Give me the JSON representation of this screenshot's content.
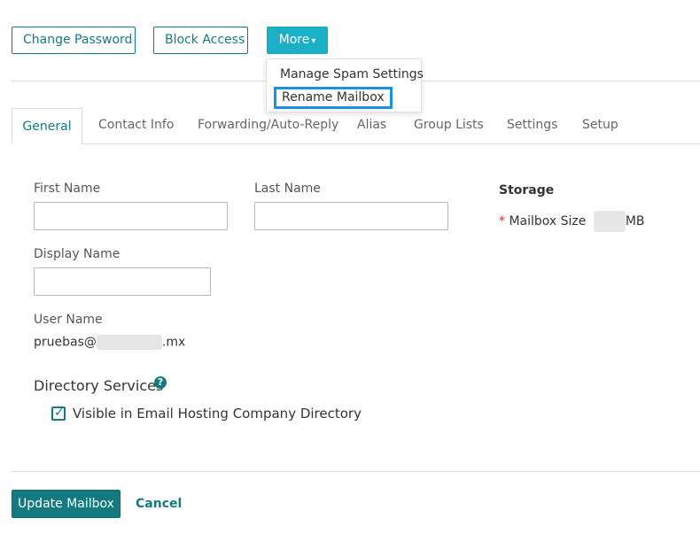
{
  "toolbar": {
    "change_password": "Change Password",
    "block_access": "Block Access",
    "more": "More"
  },
  "more_menu": {
    "items": [
      "Manage Spam Settings",
      "Rename Mailbox"
    ]
  },
  "tabs": [
    "General",
    "Contact Info",
    "Forwarding/Auto-Reply",
    "Alias",
    "Group Lists",
    "Settings",
    "Setup"
  ],
  "form": {
    "first_name_label": "First Name",
    "first_name_value": "",
    "last_name_label": "Last Name",
    "last_name_value": "",
    "display_name_label": "Display Name",
    "display_name_value": "",
    "user_name_label": "User Name",
    "user_name_prefix": "pruebas@",
    "user_name_suffix": ".mx"
  },
  "storage": {
    "title": "Storage",
    "required_marker": "*",
    "mailbox_size_label": "Mailbox Size",
    "unit": "MB"
  },
  "directory": {
    "title": "Directory Services",
    "help_glyph": "?",
    "visible_label": "Visible in Email Hosting Company Directory",
    "visible_checked": true
  },
  "footer": {
    "update": "Update Mailbox",
    "cancel": "Cancel"
  },
  "colors": {
    "accent": "#137a80",
    "more_button": "#1ab0c8",
    "focus_ring": "#1e90e0"
  }
}
